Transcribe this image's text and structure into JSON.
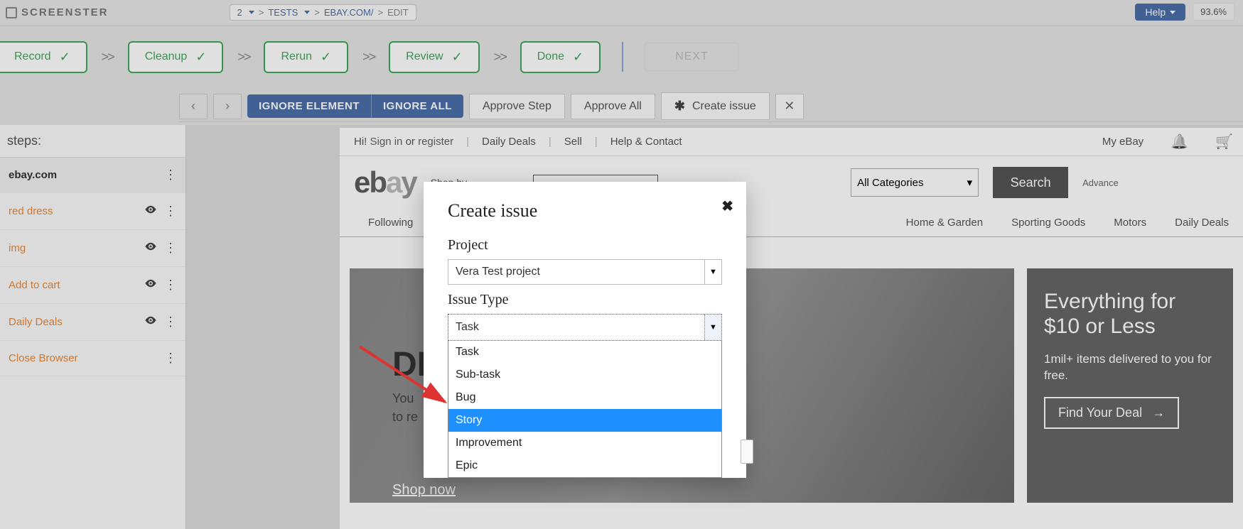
{
  "brand": "SCREENSTER",
  "breadcrumb": {
    "num": "2",
    "tests": "TESTS",
    "site": "EBAY.COM/",
    "edit": "EDIT"
  },
  "top_right": {
    "help": "Help",
    "zoom": "93.6%"
  },
  "flow": {
    "record": "Record",
    "cleanup": "Cleanup",
    "rerun": "Rerun",
    "review": "Review",
    "done": "Done",
    "next": "NEXT",
    "sep": ">>"
  },
  "toolbar": {
    "ignore_element": "IGNORE ELEMENT",
    "ignore_all": "IGNORE ALL",
    "approve_step": "Approve Step",
    "approve_all": "Approve All",
    "create_issue": "Create issue"
  },
  "sidebar": {
    "title": "steps:",
    "items": [
      {
        "label": "ebay.com",
        "bold": true,
        "eye": false
      },
      {
        "label": "red dress",
        "bold": false,
        "eye": true
      },
      {
        "label": "img",
        "bold": false,
        "eye": true
      },
      {
        "label": "Add to cart",
        "bold": false,
        "eye": true
      },
      {
        "label": "Daily Deals",
        "bold": false,
        "eye": true
      },
      {
        "label": "Close Browser",
        "bold": false,
        "eye": false
      }
    ]
  },
  "ebay": {
    "hi": "Hi!",
    "sign_in": "Sign in",
    "or": "or",
    "register": "register",
    "daily_deals": "Daily Deals",
    "sell": "Sell",
    "help_contact": "Help & Contact",
    "my_ebay": "My eBay",
    "shop_by": "Shop by",
    "categories": "All Categories",
    "search": "Search",
    "advanced": "Advance",
    "nav": {
      "following": "Following",
      "home_garden": "Home & Garden",
      "sporting": "Sporting Goods",
      "motors": "Motors",
      "deals": "Daily Deals"
    },
    "banner_left": {
      "big": "DE",
      "line1": "You",
      "line2": "to re",
      "shop_now": "Shop now"
    },
    "banner_right": {
      "title": "Everything for $10 or Less",
      "subtitle": "1mil+ items delivered to you for free.",
      "cta": "Find Your Deal"
    }
  },
  "modal": {
    "title": "Create issue",
    "project_label": "Project",
    "project_value": "Vera Test project",
    "issue_type_label": "Issue Type",
    "issue_type_value": "Task",
    "options": [
      "Task",
      "Sub-task",
      "Bug",
      "Story",
      "Improvement",
      "Epic"
    ],
    "highlighted_index": 3
  }
}
